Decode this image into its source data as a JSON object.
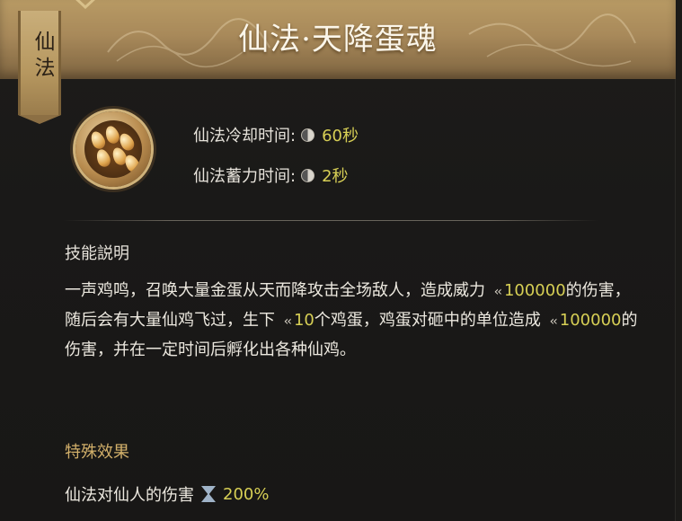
{
  "tab": {
    "label": "仙法"
  },
  "skill": {
    "title": "仙法·天降蛋魂",
    "cooldown_label": "仙法冷却时间:",
    "cooldown_value": "60秒",
    "charge_label": "仙法蓄力时间:",
    "charge_value": "2秒"
  },
  "description": {
    "heading": "技能説明",
    "text_1": "一声鸡鸣，召唤大量金蛋从天而降攻击全场敌人，造成威力",
    "damage_1": "100000",
    "text_2": "的伤害，随后会有大量仙鸡飞过，生下",
    "egg_count": "10",
    "text_3": "个鸡蛋，鸡蛋对砸中的单位造成",
    "damage_2": "100000",
    "text_4": "的伤害，并在一定时间后孵化出各种仙鸡。"
  },
  "special": {
    "heading": "特殊效果",
    "effect_label": "仙法对仙人的伤害",
    "effect_value": "200%"
  },
  "icons": {
    "skill_icon": "golden-eggs-icon",
    "cooldown_icon": "clock-icon",
    "charge_icon": "clock-icon",
    "power_icon": "arrow-left-icon",
    "bonus_icon": "hourglass-icon"
  },
  "colors": {
    "banner": "#b89a64",
    "highlight_value": "#d7cf55",
    "special_heading": "#d2b06a"
  }
}
